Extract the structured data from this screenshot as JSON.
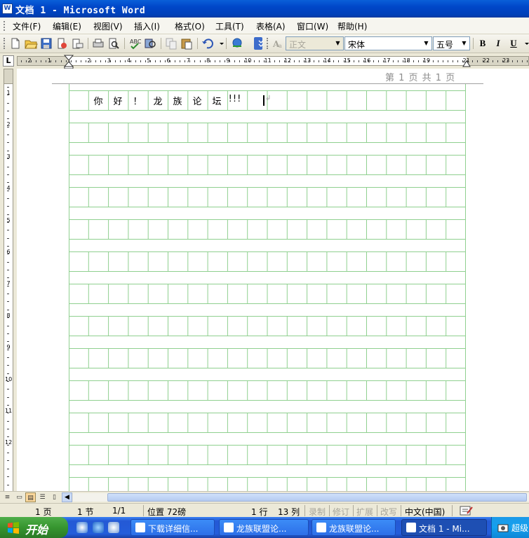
{
  "window": {
    "title": "文档 1 - Microsoft Word",
    "icon_letter": "W"
  },
  "menu": [
    "文件(F)",
    "编辑(E)",
    "视图(V)",
    "插入(I)",
    "格式(O)",
    "工具(T)",
    "表格(A)",
    "窗口(W)",
    "帮助(H)"
  ],
  "toolbar": {
    "style_value": "正文",
    "font_value": "宋体",
    "size_value": "五号",
    "bold": "B",
    "italic": "I",
    "underline": "U"
  },
  "ruler": {
    "corner": "L",
    "numbers": [
      "2",
      "1",
      "1",
      "2",
      "3",
      "4",
      "5",
      "6",
      "7",
      "8",
      "9",
      "10",
      "11",
      "12",
      "13",
      "14",
      "15",
      "16",
      "17",
      "18",
      "19",
      "21",
      "22",
      "23"
    ],
    "vertical_numbers": [
      "1",
      "2",
      "3",
      "4",
      "5",
      "6",
      "7",
      "8",
      "9",
      "10",
      "11",
      "12"
    ]
  },
  "document": {
    "header": "第 1 页 共 1 页",
    "characters": [
      "你",
      "好",
      "！",
      "龙",
      "族",
      "论",
      "坛"
    ],
    "tail": "!!!",
    "paragraph_mark": "↲"
  },
  "status": {
    "page": "1 页",
    "section": "1 节",
    "page_of": "1/1",
    "position": "位置 72磅",
    "line": "1 行",
    "column": "13 列",
    "record": "录制",
    "revise": "修订",
    "extend": "扩展",
    "overwrite": "改写",
    "language": "中文(中国)"
  },
  "taskbar": {
    "start": "开始",
    "tasks": [
      "下载详细信...",
      "龙族联盟论...",
      "龙族联盟论...",
      "文档 1 - Mi..."
    ],
    "tray": "超级"
  },
  "colors": {
    "title_blue": "#0046c8",
    "grid_green": "#8fd08f",
    "start_green": "#36952f",
    "taskbar_blue": "#245ddb"
  }
}
